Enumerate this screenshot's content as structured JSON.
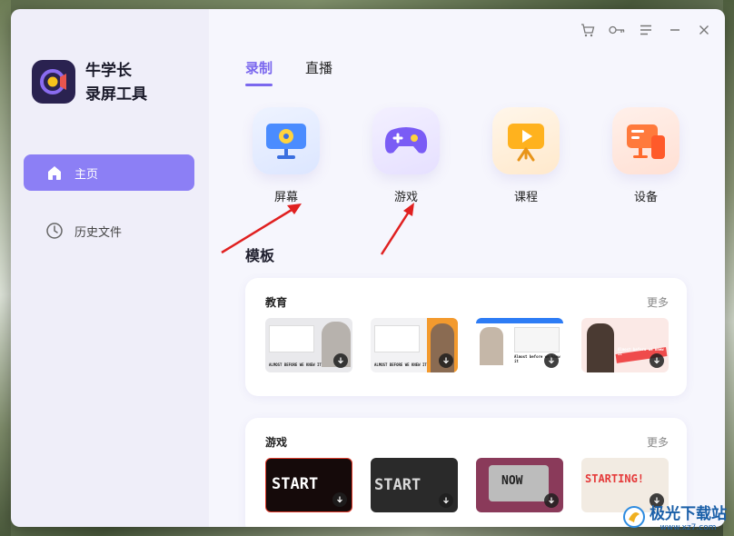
{
  "app": {
    "name_line1": "牛学长",
    "name_line2": "录屏工具"
  },
  "sidebar": {
    "items": [
      {
        "label": "主页",
        "icon": "home-icon",
        "active": true
      },
      {
        "label": "历史文件",
        "icon": "clock-icon",
        "active": false
      }
    ]
  },
  "window_controls": [
    "cart-icon",
    "key-icon",
    "menu-icon",
    "minimize-icon",
    "close-icon"
  ],
  "tabs": [
    {
      "label": "录制",
      "active": true
    },
    {
      "label": "直播",
      "active": false
    }
  ],
  "modes": [
    {
      "label": "屏幕",
      "icon": "monitor-icon"
    },
    {
      "label": "游戏",
      "icon": "gamepad-icon"
    },
    {
      "label": "课程",
      "icon": "course-video-icon"
    },
    {
      "label": "设备",
      "icon": "device-icon"
    }
  ],
  "templates": {
    "title": "模板",
    "sections": [
      {
        "title": "教育",
        "more": "更多",
        "items": [
          {
            "caption": "ALMOST BEFORE WE KNEW IT"
          },
          {
            "caption": "ALMOST BEFORE WE KNEW IT"
          },
          {
            "caption": "Almost before we knew it"
          },
          {
            "caption": "Almost before we knew it"
          }
        ]
      },
      {
        "title": "游戏",
        "more": "更多",
        "items": [
          {
            "caption": "START"
          },
          {
            "caption": "START"
          },
          {
            "caption": "NOW"
          },
          {
            "caption": "STARTING!"
          }
        ]
      }
    ]
  },
  "watermark": {
    "text": "极光下载站",
    "url": "www.xz7.com"
  },
  "colors": {
    "accent": "#8c7ff5",
    "sidebar_bg": "#efeef9",
    "main_bg": "#f6f6fd",
    "arrow": "#e02020"
  }
}
